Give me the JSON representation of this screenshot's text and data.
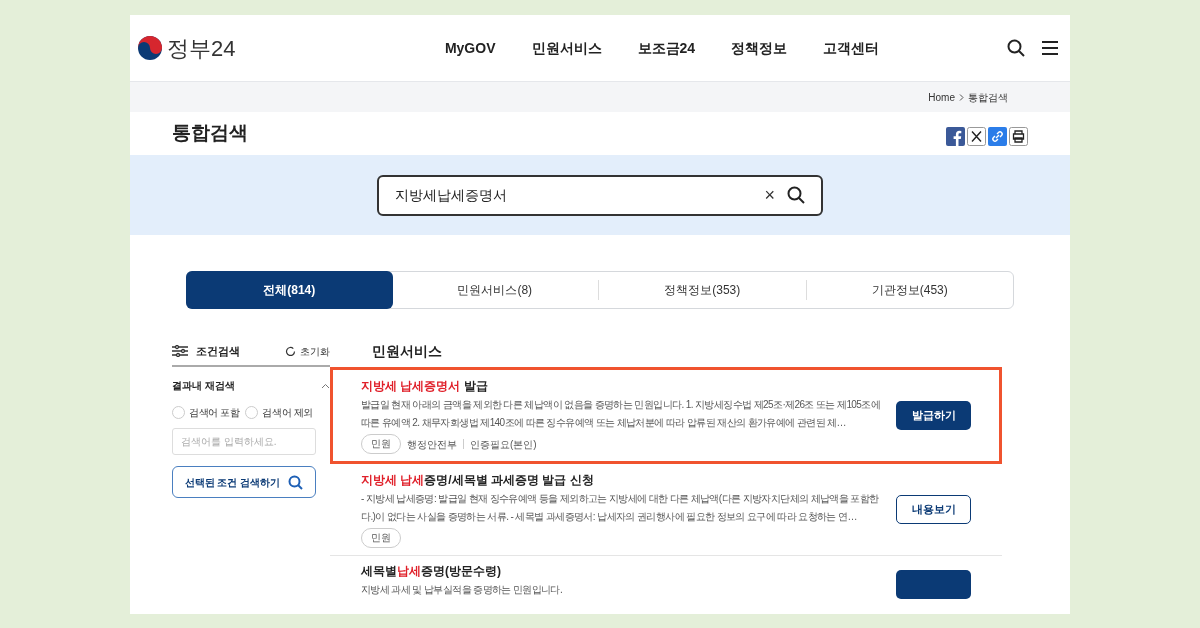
{
  "header": {
    "logo_text": "정부24",
    "nav": [
      "MyGOV",
      "민원서비스",
      "보조금24",
      "정책정보",
      "고객센터"
    ]
  },
  "breadcrumb": [
    "Home",
    "통합검색"
  ],
  "page_title": "통합검색",
  "search": {
    "value": "지방세납세증명서",
    "clear": "×"
  },
  "tabs": [
    {
      "label": "전체(814)",
      "selected": true
    },
    {
      "label": "민원서비스(8)",
      "selected": false
    },
    {
      "label": "정책정보(353)",
      "selected": false
    },
    {
      "label": "기관정보(453)",
      "selected": false
    }
  ],
  "sidebar": {
    "title": "조건검색",
    "reset": "초기화",
    "section": "결과내 재검색",
    "options": [
      {
        "label": "검색어 포함",
        "selected": false
      },
      {
        "label": "검색어 제외",
        "selected": false
      }
    ],
    "placeholder": "검색어를 입력하세요.",
    "submit": "선택된 조건 검색하기"
  },
  "results": {
    "heading": "민원서비스",
    "items": [
      {
        "highlighted": true,
        "title": [
          {
            "text": "지방세 납세증명서",
            "hit": true
          },
          {
            "text": " 발급",
            "hit": false
          }
        ],
        "description": "발급일 현재 아래의 금액을 제외한 다른 체납액이 없음을 증명하는 민원입니다. 1. 지방세징수법 제25조·제26조 또는 제105조에 따른 유예액 2. 채무자회생법 제140조에 따른 징수유예액 또는 체납처분에 따라 압류된 재산의 환가유예에 관련된 체…",
        "tags": [
          "민원"
        ],
        "meta": [
          "행정안전부",
          "인증필요(본인)"
        ],
        "button": {
          "label": "발급하기",
          "kind": "primary"
        }
      },
      {
        "highlighted": false,
        "title": [
          {
            "text": "지방세 납세",
            "hit": true
          },
          {
            "text": "증명/세목별 과세증명 발급 신청",
            "hit": false
          }
        ],
        "description": "- 지방세 납세증명: 발급일 현재 징수유예액 등을 제외하고는 지방세에 대한 다른 체납액(다른 지방자치단체의 체납액을 포함한다.)이 없다는 사실을 증명하는 서류. - 세목별 과세증명서: 납세자의 권리행사에 필요한 정보의 요구에 따라 요청하는 연…",
        "tags": [
          "민원"
        ],
        "button": {
          "label": "내용보기",
          "kind": "outline"
        }
      },
      {
        "highlighted": false,
        "title": [
          {
            "text": "세목별",
            "hit": false
          },
          {
            "text": "납세",
            "hit": true
          },
          {
            "text": "증명(방문수령)",
            "hit": false
          }
        ],
        "description": "지방세 과세 및 납부실적을 증명하는 민원입니다.",
        "button": {
          "kind": "primary"
        }
      }
    ]
  }
}
